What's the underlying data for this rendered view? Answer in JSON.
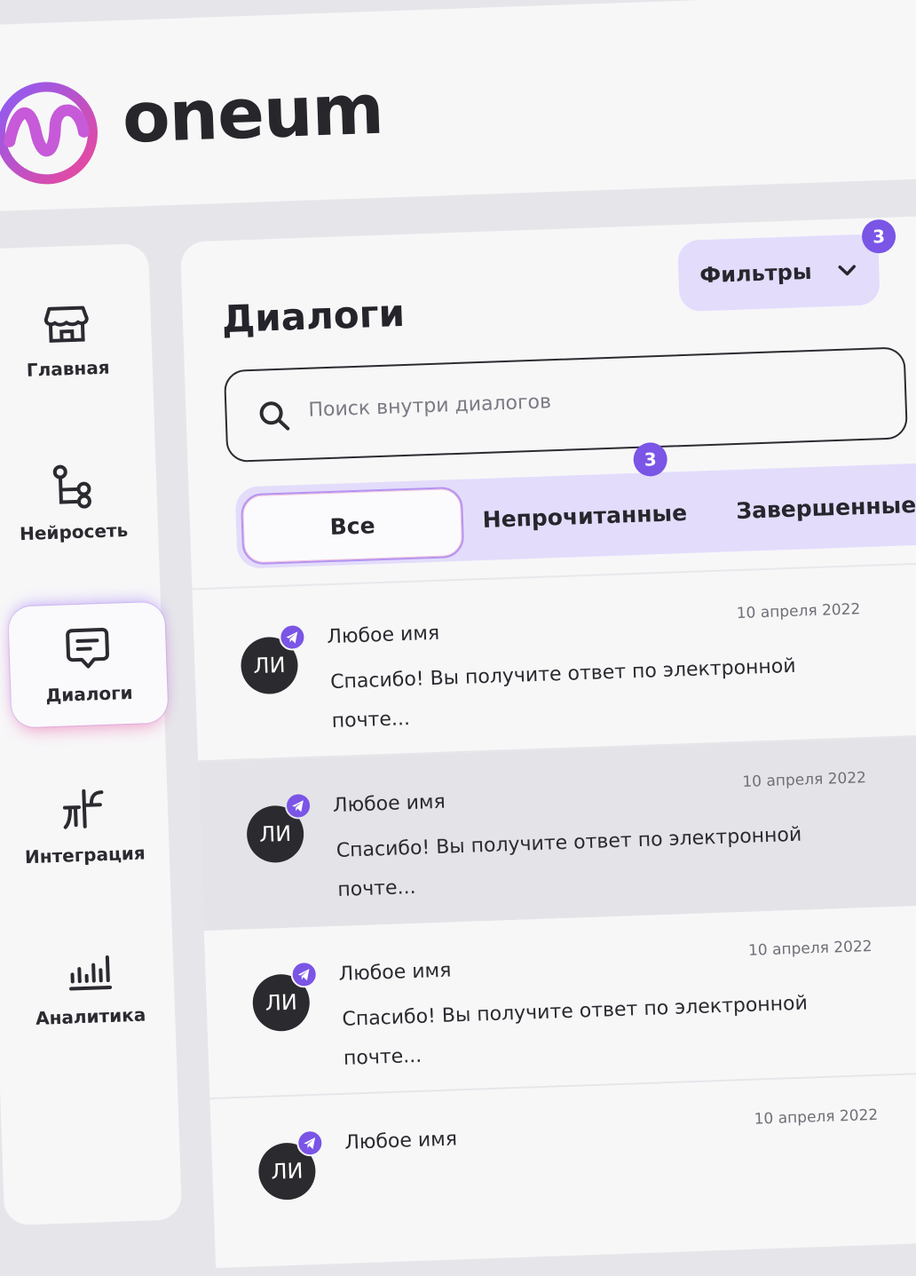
{
  "header": {
    "logo_text": "oneum"
  },
  "sidebar": {
    "items": [
      {
        "label": "Главная",
        "icon": "store-icon"
      },
      {
        "label": "Нейросеть",
        "icon": "network-icon"
      },
      {
        "label": "Диалоги",
        "icon": "chat-icon",
        "active": true
      },
      {
        "label": "Интеграция",
        "icon": "integration-icon"
      },
      {
        "label": "Аналитика",
        "icon": "analytics-icon"
      }
    ]
  },
  "main": {
    "title": "Диалоги",
    "filters": {
      "label": "Фильтры",
      "badge": "3"
    },
    "search": {
      "placeholder": "Поиск внутри диалогов"
    },
    "tabs": [
      {
        "label": "Все",
        "active": true
      },
      {
        "label": "Непрочитанные",
        "badge": "3"
      },
      {
        "label": "Завершенные"
      }
    ],
    "dialogs": [
      {
        "initials": "ЛИ",
        "name": "Любое имя",
        "date": "10 апреля 2022",
        "message": "Спасибо! Вы получите ответ по электронной почте..."
      },
      {
        "initials": "ЛИ",
        "name": "Любое имя",
        "date": "10 апреля 2022",
        "message": "Спасибо! Вы получите ответ по электронной почте...",
        "selected": true
      },
      {
        "initials": "ЛИ",
        "name": "Любое имя",
        "date": "10 апреля 2022",
        "message": "Спасибо! Вы получите ответ по электронной почте..."
      },
      {
        "initials": "ЛИ",
        "name": "Любое имя",
        "date": "10 апреля 2022",
        "message": ""
      }
    ]
  },
  "colors": {
    "accent": "#7a55e6",
    "accent_light": "#e3dcfb",
    "brand_pink": "#ec4899",
    "brand_purple": "#8b5cf6"
  }
}
